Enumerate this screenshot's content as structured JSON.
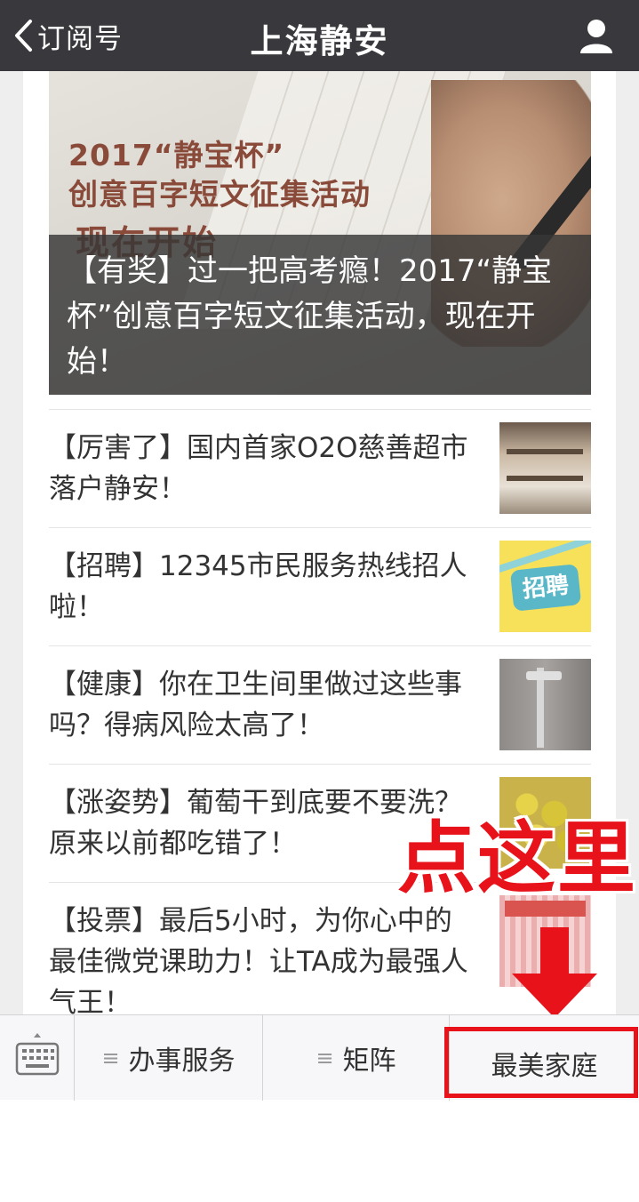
{
  "navbar": {
    "back_label": "订阅号",
    "title": "上海静安",
    "back_icon": "chevron-left-icon",
    "user_icon": "user-icon"
  },
  "banner": {
    "image_line1": "2017“静宝杯”",
    "image_line2": "创意百字短文征集活动",
    "image_line3": "现在开始",
    "title": "【有奖】过一把高考瘾！2017“静宝杯”创意百字短文征集活动，现在开始！"
  },
  "articles": [
    {
      "title": "【厉害了】国内首家O2O慈善超市落户静安！"
    },
    {
      "title": "【招聘】12345市民服务热线招人啦！",
      "thumb_text": "招聘"
    },
    {
      "title": "【健康】你在卫生间里做过这些事吗？得病风险太高了！"
    },
    {
      "title": "【涨姿势】葡萄干到底要不要洗？原来以前都吃错了！"
    },
    {
      "title": "【投票】最后5小时，为你心中的最佳微党课助力！让TA成为最强人气王！"
    }
  ],
  "annotation": {
    "text": "点这里",
    "color": "#e8121a"
  },
  "menubar": {
    "keyboard_icon": "keyboard-icon",
    "items": [
      {
        "label": "办事服务",
        "icon": "menu-lines-icon"
      },
      {
        "label": "矩阵",
        "icon": "menu-lines-icon"
      },
      {
        "label": "最美家庭"
      }
    ]
  },
  "colors": {
    "navbar": "#39393d",
    "highlight": "#e8121a"
  }
}
